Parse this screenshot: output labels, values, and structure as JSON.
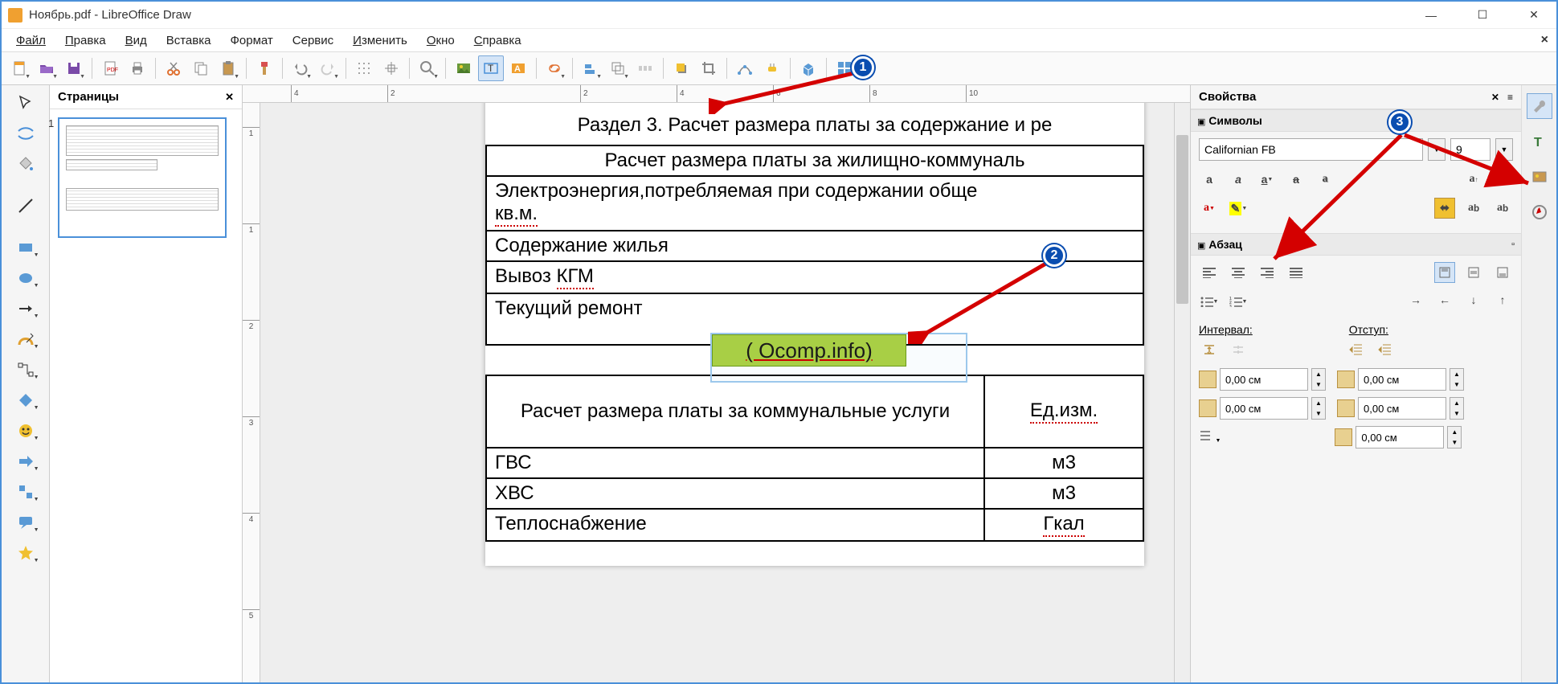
{
  "window": {
    "title": "Ноябрь.pdf - LibreOffice Draw"
  },
  "menu": {
    "file": "Файл",
    "edit": "Правка",
    "view": "Вид",
    "insert": "Вставка",
    "format": "Формат",
    "tools": "Сервис",
    "modify": "Изменить",
    "window": "Окно",
    "help": "Справка"
  },
  "pages_panel": {
    "title": "Страницы",
    "page_number": "1"
  },
  "ruler_h": {
    "t1": "4",
    "t2": "2",
    "t3": "2",
    "t4": "4",
    "t5": "6",
    "t6": "8",
    "t7": "10"
  },
  "ruler_v": {
    "t1": "1",
    "t2": "1",
    "t3": "2",
    "t4": "3",
    "t5": "4",
    "t6": "5"
  },
  "document": {
    "heading": "Раздел 3. Расчет размера платы за содержание и ре",
    "subheading": "Расчет размера платы за жилищно-коммуналь",
    "row1": "Электроэнергия,потребляемая при содержании обще",
    "row1b": "кв.м.",
    "row2": "Содержание жилья",
    "row3": "Вывоз КГМ",
    "row4": "Текущий ремонт",
    "inserted": "( Ocomp.info)",
    "calc_header": "Расчет размера платы за коммунальные услуги",
    "unit_header": "Ед.изм.",
    "gvs": "ГВС",
    "gvs_unit": "м3",
    "hvs": "ХВС",
    "hvs_unit": "м3",
    "heat": "Теплоснабжение",
    "heat_unit": "Гкал"
  },
  "properties": {
    "title": "Свойства",
    "section_chars": "Символы",
    "font_name": "Californian FB",
    "font_size": "9",
    "section_para": "Абзац",
    "interval_label": "Интервал:",
    "indent_label": "Отступ:",
    "spacing1": "0,00 см",
    "spacing2": "0,00 см",
    "indent1": "0,00 см",
    "indent2": "0,00 см",
    "indent3": "0,00 см"
  },
  "badges": {
    "b1": "1",
    "b2": "2",
    "b3": "3"
  }
}
